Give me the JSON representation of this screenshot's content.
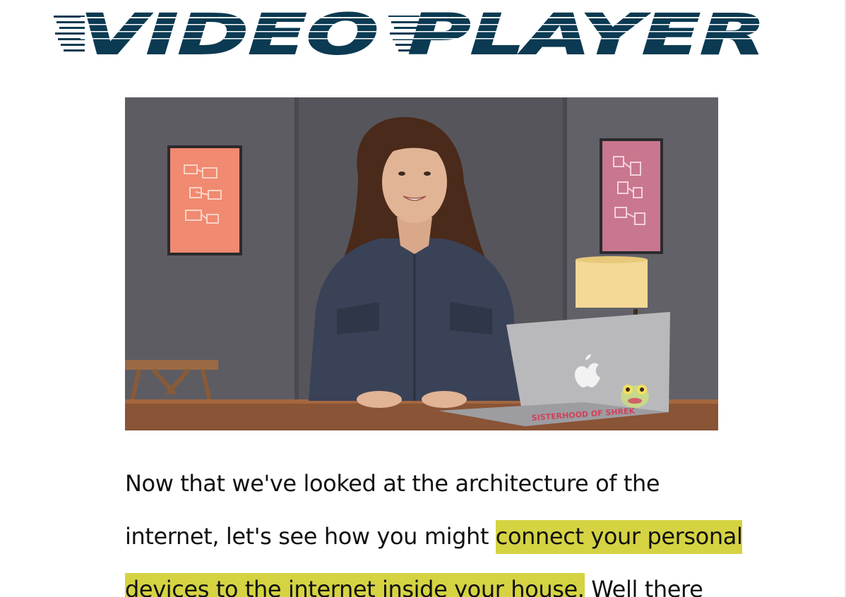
{
  "header": {
    "title": "VIDEO PLAYER",
    "title_color": "#0b3a52"
  },
  "video": {
    "description_colors": {
      "wall": "#56555b",
      "desk": "#8a5436",
      "left_poster": "#f08a70",
      "right_poster": "#c9778e",
      "lamp": "#f3d896",
      "laptop": "#b9b9bc"
    },
    "laptop_sticker_text": "SISTERHOOD OF SHREK"
  },
  "transcript": {
    "line1": "Now that we've looked at the architecture of the",
    "line2_plain": "internet, let's see how you might ",
    "line2_highlight": "connect your personal",
    "line3_highlight": "devices to the internet inside your house.",
    "line3_plain": " Well there",
    "highlight_color": "#d5d342"
  }
}
